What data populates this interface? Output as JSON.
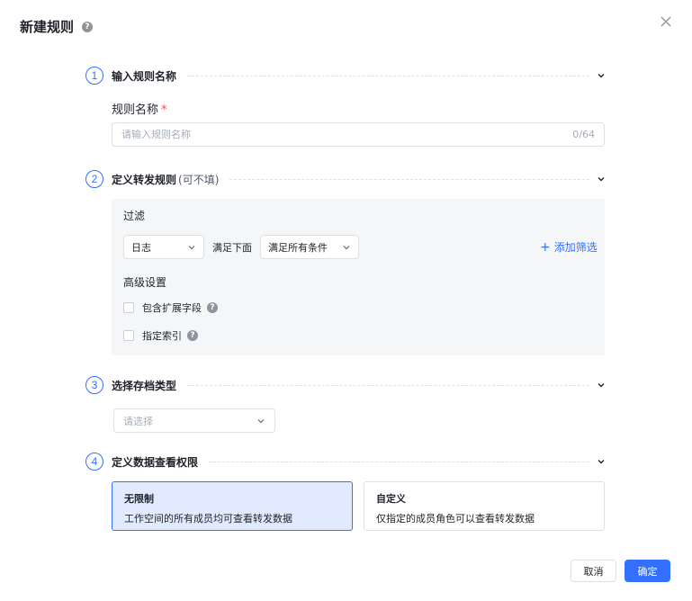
{
  "dialog": {
    "title": "新建规则",
    "help_glyph": "?"
  },
  "steps": [
    {
      "number": "1",
      "title": "输入规则名称",
      "subtitle": ""
    },
    {
      "number": "2",
      "title": "定义转发规则",
      "subtitle": "(可不填)"
    },
    {
      "number": "3",
      "title": "选择存档类型",
      "subtitle": ""
    },
    {
      "number": "4",
      "title": "定义数据查看权限",
      "subtitle": ""
    }
  ],
  "rule_name": {
    "label": "规则名称",
    "required_mark": "*",
    "placeholder": "请输入规则名称",
    "value": "",
    "counter": "0/64"
  },
  "filter": {
    "section_label": "过滤",
    "source_select": "日志",
    "match_text": "满足下面",
    "condition_select": "满足所有条件",
    "add_filter_icon": "+",
    "add_filter_label": "添加筛选",
    "advanced_label": "高级设置",
    "options": [
      {
        "label": "包含扩展字段",
        "checked": false
      },
      {
        "label": "指定索引",
        "checked": false
      }
    ]
  },
  "archive": {
    "placeholder": "请选择"
  },
  "permission": {
    "cards": [
      {
        "title": "无限制",
        "desc": "工作空间的所有成员均可查看转发数据",
        "selected": true
      },
      {
        "title": "自定义",
        "desc": "仅指定的成员角色可以查看转发数据",
        "selected": false
      }
    ]
  },
  "footer": {
    "cancel": "取消",
    "confirm": "确定"
  },
  "colors": {
    "accent": "#3370ff",
    "required": "#f54a45",
    "selected_bg": "#e1eaff",
    "panel_bg": "#f5f6f7"
  }
}
